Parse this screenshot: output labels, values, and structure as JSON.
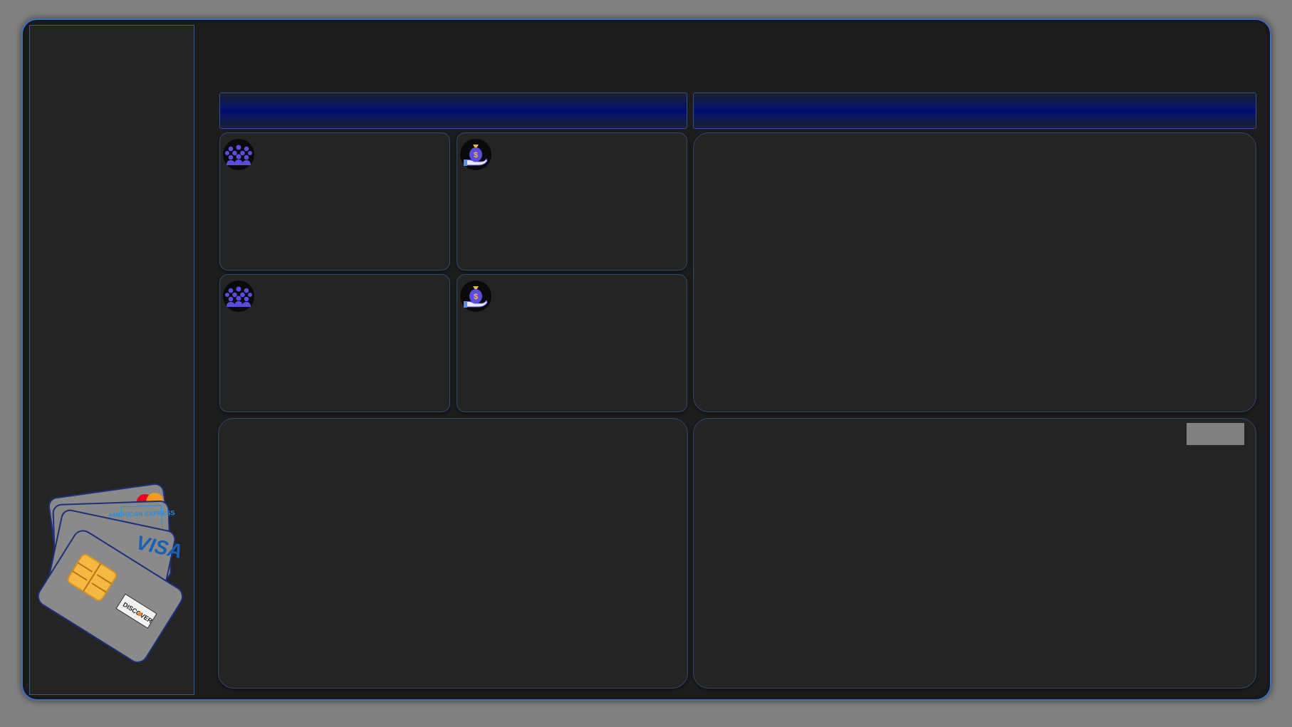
{
  "window": {
    "title": ""
  },
  "sidebar": {
    "illustration": {
      "icon": "credit-cards-illustration",
      "brands": [
        "mastercard-logo",
        "american-express-logo",
        "visa-logo",
        "discover-logo"
      ],
      "visible_text": [
        "AMERICAN EXPRESS",
        "VISA",
        "DISCOVER"
      ]
    }
  },
  "banners": [
    {
      "label": ""
    },
    {
      "label": ""
    }
  ],
  "kpi_cards": [
    {
      "icon": "people-group-icon",
      "title": "",
      "value": ""
    },
    {
      "icon": "money-bag-hand-icon",
      "title": "",
      "value": ""
    },
    {
      "icon": "people-group-icon",
      "title": "",
      "value": ""
    },
    {
      "icon": "money-bag-hand-icon",
      "title": "",
      "value": ""
    }
  ],
  "panels": {
    "right_top": {
      "title": ""
    },
    "bottom_left": {
      "title": ""
    },
    "bottom_right": {
      "title": "",
      "button_label": ""
    }
  },
  "colors": {
    "frame_border": "#3a6fc4",
    "banner_fill": "#000c70",
    "icon_purple": "#5b4ce0",
    "panel_background": "#242424",
    "page_background": "#808080"
  }
}
